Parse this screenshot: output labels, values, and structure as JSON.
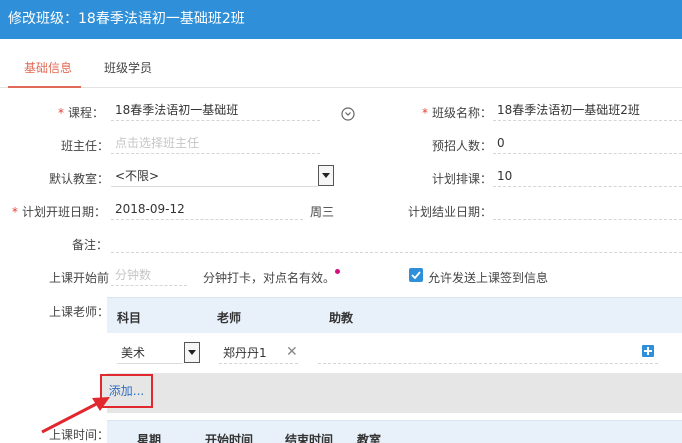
{
  "title": "修改班级：18春季法语初一基础班2班",
  "tabs": {
    "basic": "基础信息",
    "students": "班级学员"
  },
  "form": {
    "course_label": "课程：",
    "course_value": "18春季法语初一基础班",
    "class_name_label": "班级名称：",
    "class_name_value": "18春季法语初一基础班2班",
    "teacher_label": "班主任：",
    "teacher_placeholder": "点击选择班主任",
    "enroll_label": "预招人数：",
    "enroll_value": "0",
    "classroom_label": "默认教室：",
    "classroom_value": "<不限>",
    "sessions_label": "计划排课：",
    "sessions_value": "10",
    "start_label": "计划开班日期：",
    "start_value": "2018-09-12",
    "weekday": "周三",
    "end_label": "计划结业日期：",
    "end_value": "",
    "remark_label": "备注：",
    "remark_value": "",
    "pre_label": "上课开始前",
    "pre_placeholder": "分钟数",
    "pre_suffix": "分钟打卡，对点名有效。",
    "allow_checkin": "允许发送上课签到信息",
    "allow_checked": true
  },
  "teachers_grid": {
    "label": "上课老师：",
    "headers": {
      "subject": "科目",
      "teacher": "老师",
      "assistant": "助教"
    },
    "row": {
      "subject": "美术",
      "teacher": "郑丹丹1",
      "assistant": ""
    },
    "add_label": "添加..."
  },
  "schedule_grid": {
    "label": "上课时间：",
    "headers": [
      "星期",
      "开始时间",
      "结束时间",
      "教室"
    ]
  },
  "colors": {
    "header": "#2f8fd8",
    "accent": "#e06a57",
    "highlight_box": "#e0282e"
  }
}
